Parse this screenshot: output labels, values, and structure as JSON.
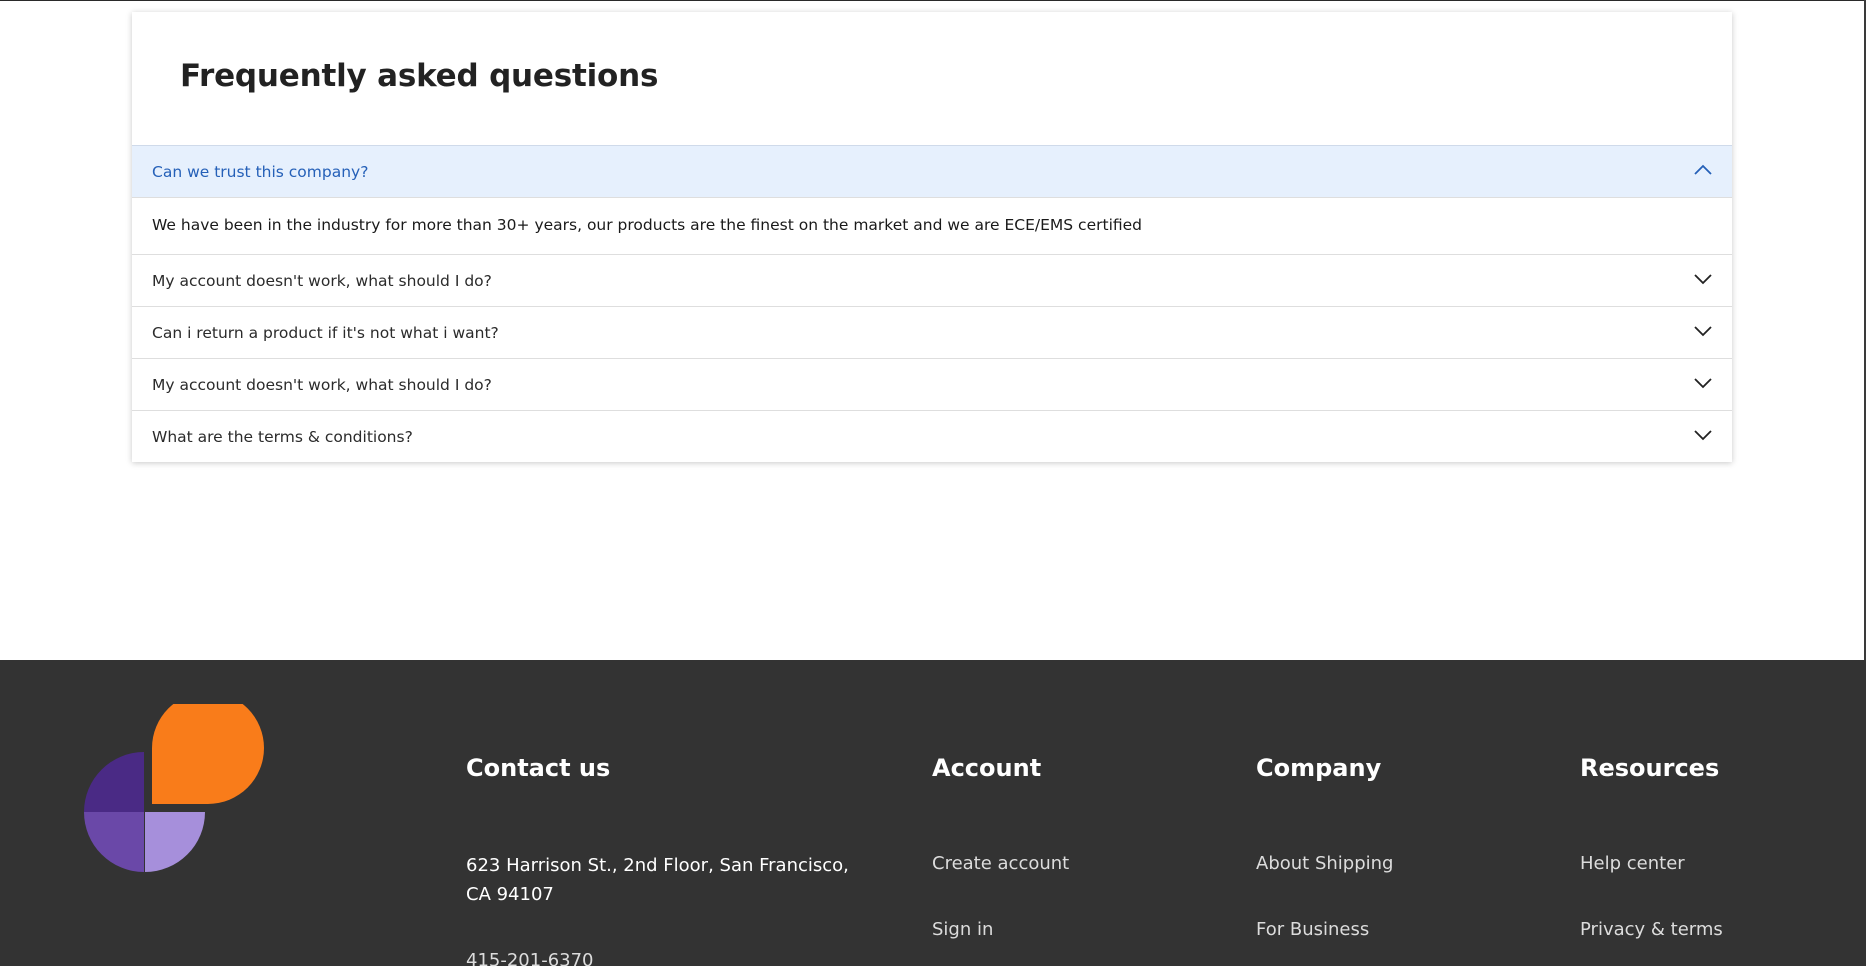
{
  "faq": {
    "title": "Frequently asked questions",
    "open_item": {
      "question": "Can we trust this company?",
      "answer": "We have been in the industry for more than 30+ years, our products are the finest on the market and we are ECE/EMS certified"
    },
    "items": [
      {
        "question": "My account doesn't work, what should I do?"
      },
      {
        "question": "Can i return a product if it's not what i want?"
      },
      {
        "question": "My account doesn't work, what should I do?"
      },
      {
        "question": "What are the terms & conditions?"
      }
    ]
  },
  "footer": {
    "contact": {
      "heading": "Contact us",
      "address": "623 Harrison St., 2nd Floor, San Francisco, CA 94107",
      "phone": "415-201-6370"
    },
    "account": {
      "heading": "Account",
      "links": [
        "Create account",
        "Sign in"
      ]
    },
    "company": {
      "heading": "Company",
      "links": [
        "About Shipping",
        "For Business"
      ]
    },
    "resources": {
      "heading": "Resources",
      "links": [
        "Help center",
        "Privacy & terms"
      ]
    }
  },
  "colors": {
    "accent_blue": "#2560b8",
    "open_row_bg": "#e6f0fd",
    "footer_bg": "#333333",
    "logo_orange": "#f97c1a",
    "logo_purple_dark": "#4a2a85",
    "logo_purple_mid": "#6a48a8",
    "logo_purple_light": "#a68fdb"
  }
}
